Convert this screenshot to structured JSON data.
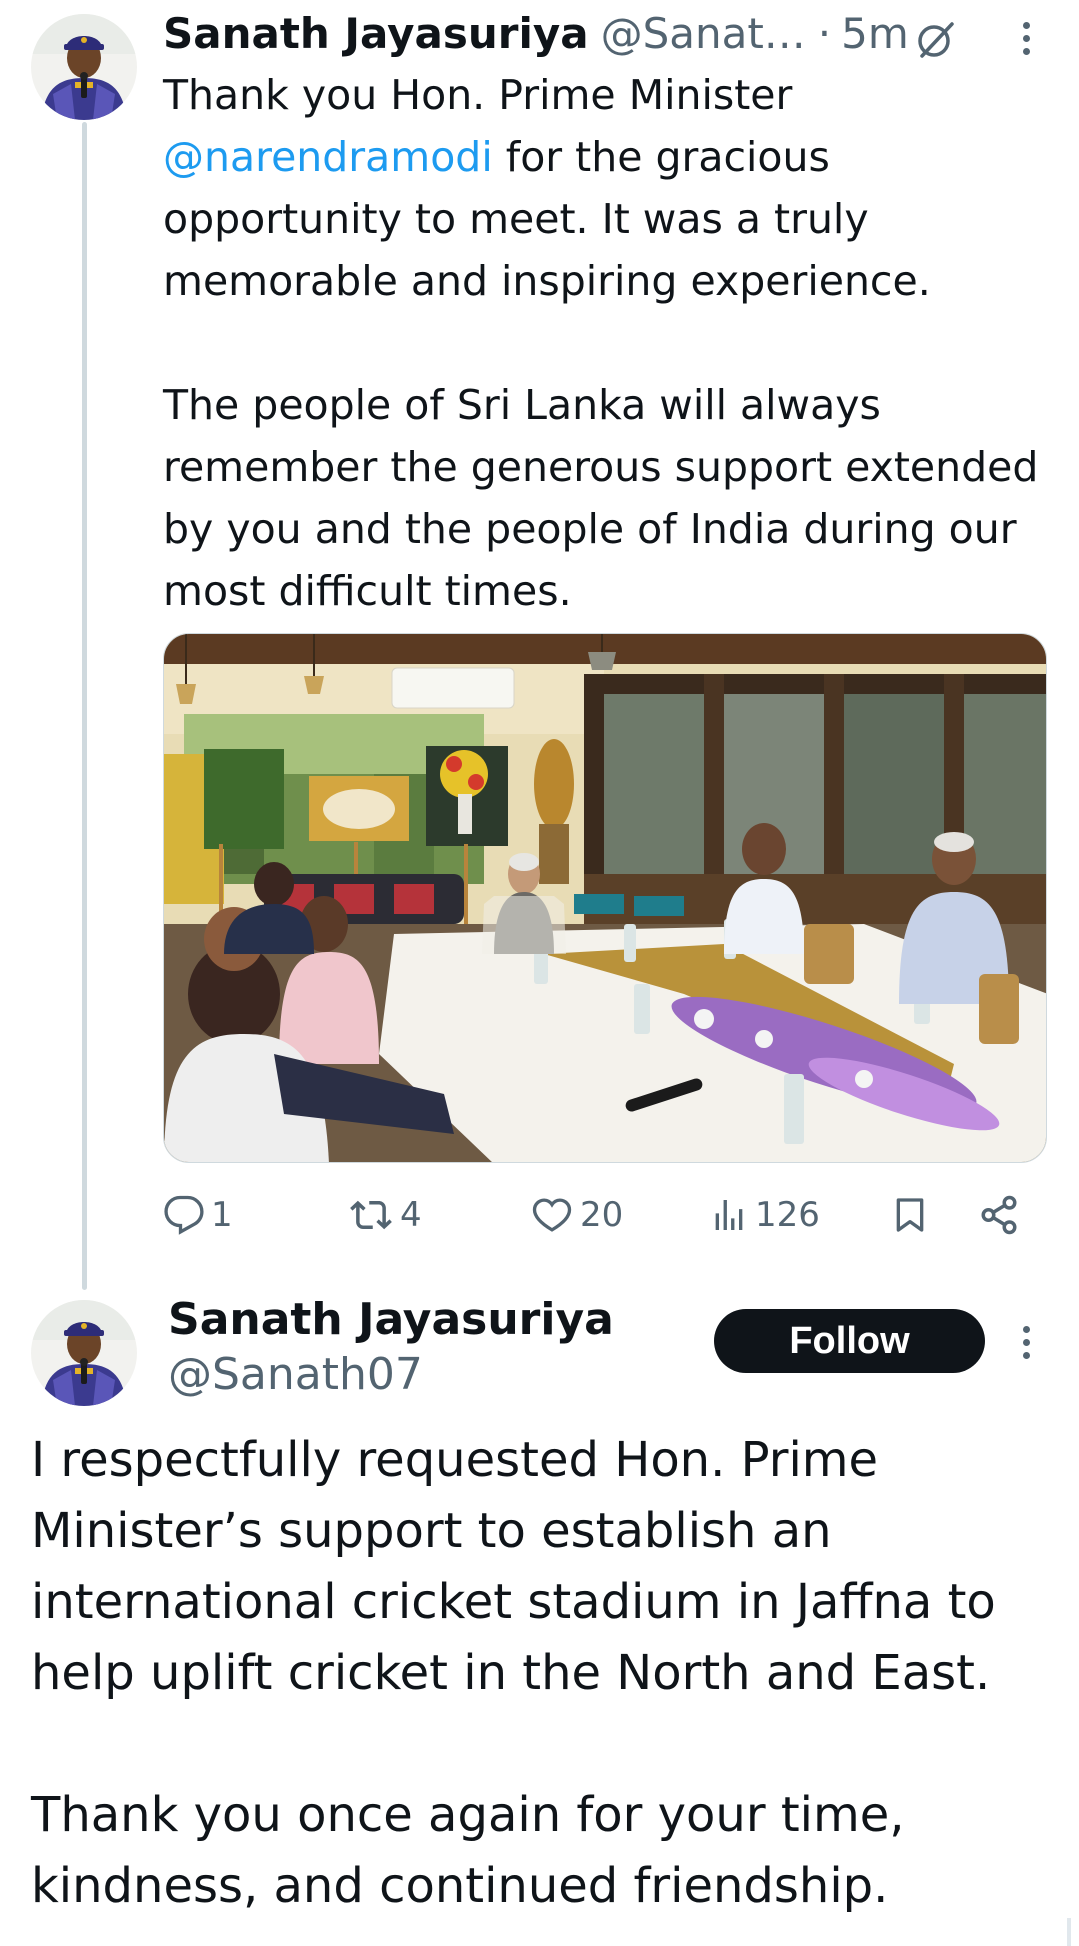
{
  "tweet1": {
    "author_name": "Sanath Jayasuriya",
    "author_handle": "@Sanat…",
    "separator": "·",
    "time": "5m",
    "mention": "@narendramodi",
    "text_line_start": "Thank you Hon. Prime Minister",
    "text_after_mention": " for the gracious opportunity to meet. It was a truly memorable and inspiring experience.",
    "paragraph2": "The people of Sri Lanka will always remember the generous support extended by you and the people of India during our most difficult times.",
    "icons": {
      "grok": "grok-icon",
      "more": "more-icon",
      "reply": "reply-icon",
      "retweet": "retweet-icon",
      "like": "heart-icon",
      "views": "views-icon",
      "bookmark": "bookmark-icon",
      "share": "share-icon"
    },
    "stats": {
      "replies": "1",
      "retweets": "4",
      "likes": "20",
      "views": "126"
    }
  },
  "tweet2": {
    "author_name": "Sanath Jayasuriya",
    "author_handle": "@Sanath07",
    "follow_label": "Follow",
    "paragraph1": "I respectfully requested Hon. Prime Minister’s support to establish an international cricket stadium in Jaffna to help uplift cricket in the North and East.",
    "paragraph2": "Thank you once again for your time, kindness, and continued friendship."
  },
  "colors": {
    "text": "#0f1419",
    "secondary": "#536471",
    "link": "#1d9bf0",
    "thread_line": "#cfd9de",
    "button_bg": "#0f1419"
  }
}
